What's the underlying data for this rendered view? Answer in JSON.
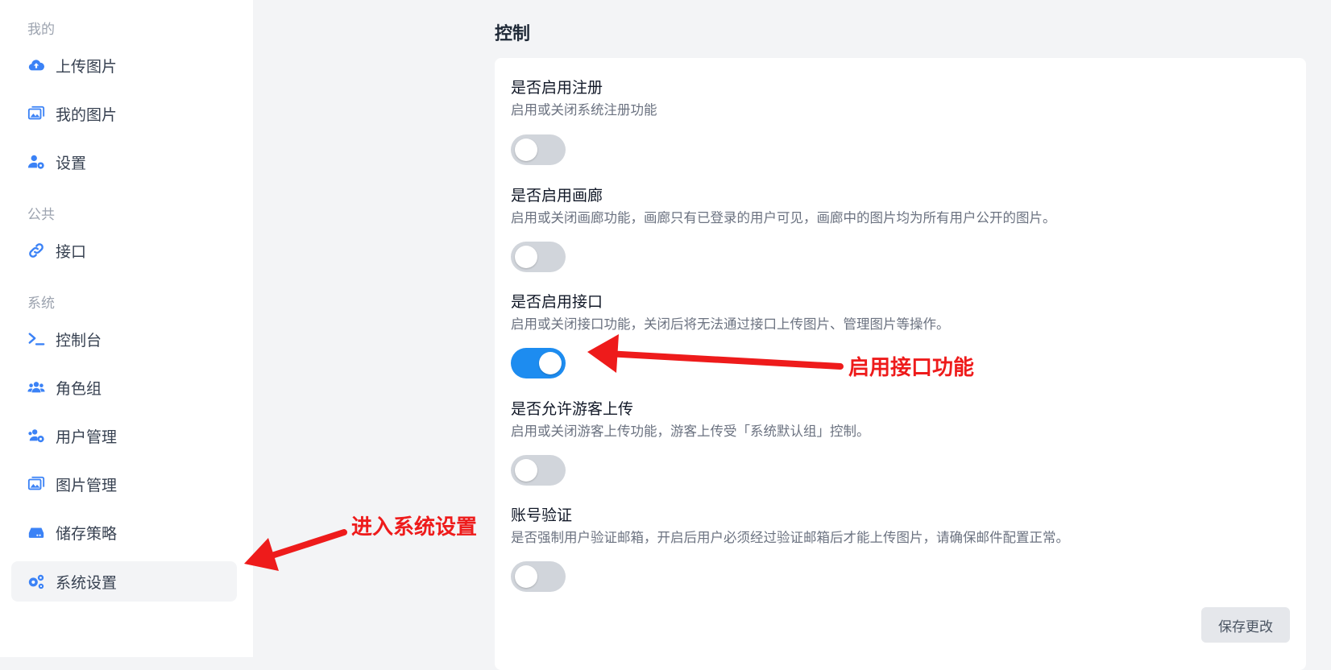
{
  "sidebar": {
    "sections": [
      {
        "title": "我的",
        "items": [
          {
            "label": "上传图片",
            "icon": "cloud-upload-icon"
          },
          {
            "label": "我的图片",
            "icon": "images-icon"
          },
          {
            "label": "设置",
            "icon": "user-gear-icon"
          }
        ]
      },
      {
        "title": "公共",
        "items": [
          {
            "label": "接口",
            "icon": "link-icon"
          }
        ]
      },
      {
        "title": "系统",
        "items": [
          {
            "label": "控制台",
            "icon": "terminal-icon"
          },
          {
            "label": "角色组",
            "icon": "users-icon"
          },
          {
            "label": "用户管理",
            "icon": "users-gear-icon"
          },
          {
            "label": "图片管理",
            "icon": "images-icon"
          },
          {
            "label": "储存策略",
            "icon": "hard-drive-icon"
          },
          {
            "label": "系统设置",
            "icon": "gears-icon",
            "active": true
          }
        ]
      }
    ],
    "accent_color": "#3b82f6"
  },
  "main": {
    "title": "控制",
    "settings": [
      {
        "title": "是否启用注册",
        "description": "启用或关闭系统注册功能",
        "enabled": false
      },
      {
        "title": "是否启用画廊",
        "description": "启用或关闭画廊功能，画廊只有已登录的用户可见，画廊中的图片均为所有用户公开的图片。",
        "enabled": false
      },
      {
        "title": "是否启用接口",
        "description": "启用或关闭接口功能，关闭后将无法通过接口上传图片、管理图片等操作。",
        "enabled": true
      },
      {
        "title": "是否允许游客上传",
        "description": "启用或关闭游客上传功能，游客上传受「系统默认组」控制。",
        "enabled": false
      },
      {
        "title": "账号验证",
        "description": "是否强制用户验证邮箱，开启后用户必须经过验证邮箱后才能上传图片，请确保邮件配置正常。",
        "enabled": false
      }
    ],
    "save_label": "保存更改",
    "toggle_on_color": "#1d8cf0",
    "toggle_off_color": "#d1d5db"
  },
  "annotations": {
    "enable_api": "启用接口功能",
    "enter_settings": "进入系统设置",
    "color": "#ee1b1b"
  }
}
